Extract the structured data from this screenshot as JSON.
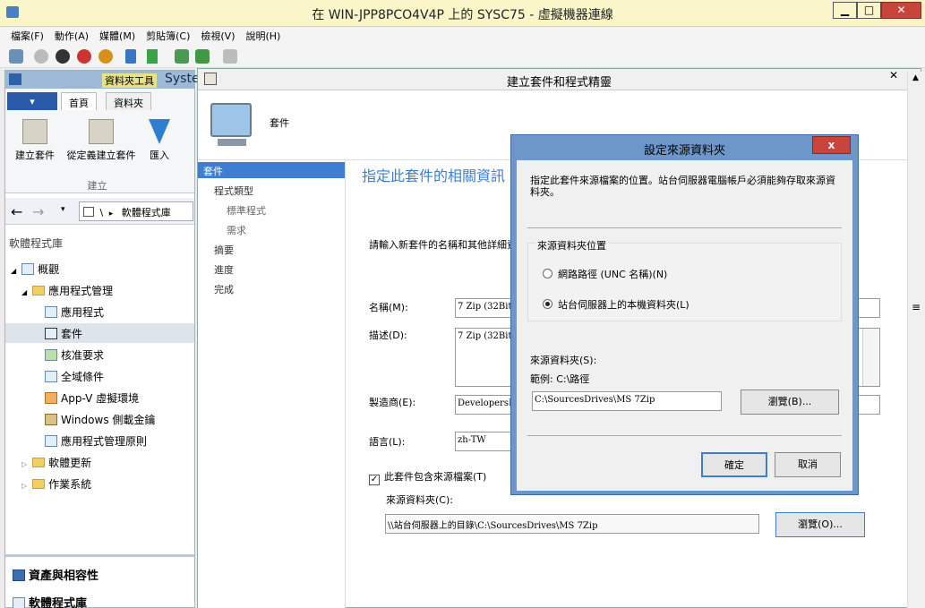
{
  "window": {
    "title": "在 WIN-JPP8PCO4V4P 上的 SYSC75 - 虛擬機器連線",
    "min": "▁",
    "max": "□",
    "close": "✕"
  },
  "menu": [
    "檔案(F)",
    "動作(A)",
    "媒體(M)",
    "剪貼簿(C)",
    "檢視(V)",
    "說明(H)"
  ],
  "console": {
    "title_tab": "資料夾工具",
    "title_text": "Syste",
    "tabs": [
      "首頁",
      "資料夾"
    ],
    "ribbon_buttons": [
      "建立套件",
      "從定義建立套件",
      "匯入"
    ],
    "ribbon_group": "建立",
    "breadcrumb_sep": "\\",
    "breadcrumb_arrow": "▸",
    "breadcrumb": "軟體程式庫",
    "section_title": "軟體程式庫",
    "tree": [
      "概觀",
      "應用程式管理",
      "應用程式",
      "套件",
      "核准要求",
      "全域條件",
      "App-V 虛擬環境",
      "Windows 側載金鑰",
      "應用程式管理原則",
      "軟體更新",
      "作業系統"
    ],
    "bottom": [
      "資產與相容性",
      "軟體程式庫"
    ]
  },
  "wizard": {
    "title": "建立套件和程式精靈",
    "close": "✕",
    "header": "套件",
    "steps": [
      "套件",
      "程式類型",
      "標準程式",
      "需求",
      "摘要",
      "進度",
      "完成"
    ],
    "heading": "指定此套件的相關資訊",
    "intro": "請輸入新套件的名稱和其他詳細資料",
    "name_label": "名稱(M):",
    "name_value": "7 Zip (32Bit)",
    "desc_label": "描述(D):",
    "desc_value": "7 Zip (32Bit)",
    "mfr_label": "製造商(E):",
    "mfr_value": "DevelopersHo",
    "lang_label": "語言(L):",
    "lang_value": "zh-TW",
    "checkbox_label": "此套件包含來源檔案(T)",
    "source_label": "來源資料夾(C):",
    "source_value": "\\\\站台伺服器上的目錄\\C:\\SourcesDrives\\MS 7Zip",
    "browse": "瀏覽(O)..."
  },
  "dialog": {
    "title": "設定來源資料夾",
    "close": "x",
    "intro": "指定此套件來源檔案的位置。站台伺服器電腦帳戶必須能夠存取來源資料夾。",
    "group_title": "來源資料夾位置",
    "option_unc": "網路路徑 (UNC 名稱)(N)",
    "option_local": "站台伺服器上的本機資料夾(L)",
    "source_label": "來源資料夾(S):",
    "example": "範例: C:\\路徑",
    "source_value": "C:\\SourcesDrives\\MS 7Zip",
    "browse": "瀏覽(B)...",
    "ok": "確定",
    "cancel": "取消"
  }
}
